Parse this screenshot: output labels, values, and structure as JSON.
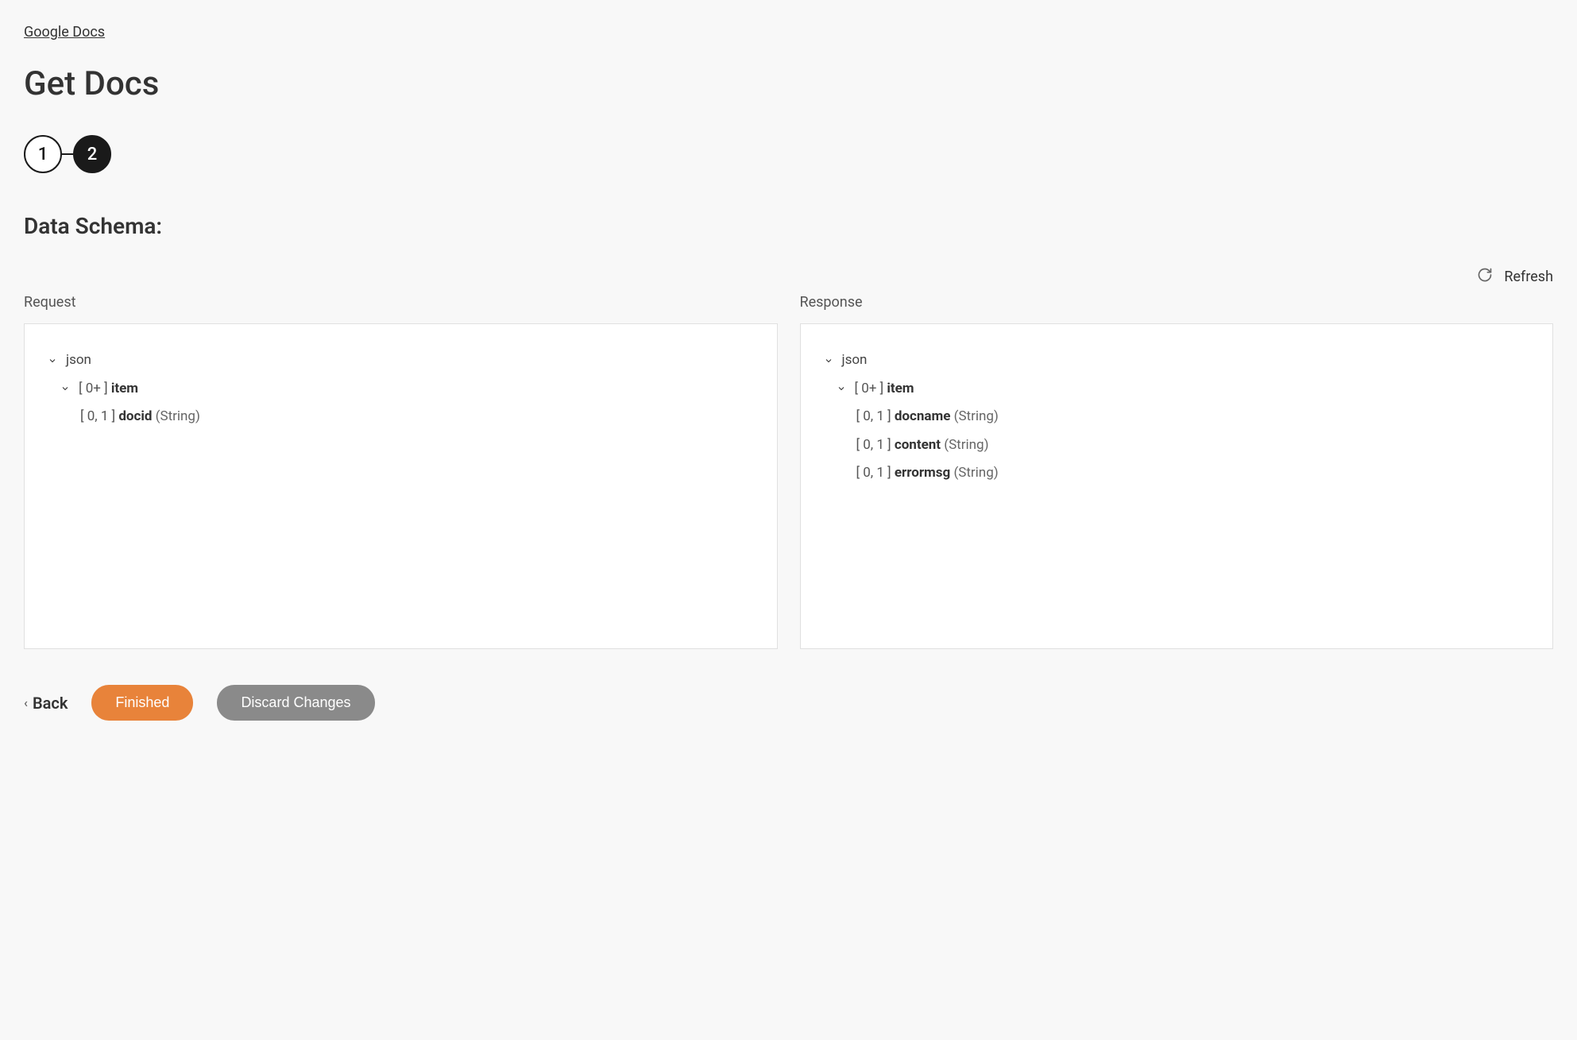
{
  "breadcrumb": {
    "label": "Google Docs"
  },
  "page_title": "Get Docs",
  "stepper": {
    "steps": [
      "1",
      "2"
    ],
    "active_index": 1
  },
  "section_title": "Data Schema:",
  "refresh": {
    "label": "Refresh"
  },
  "request": {
    "title": "Request",
    "root_label": "json",
    "item_prefix": "[ 0+ ]",
    "item_name": "item",
    "fields": [
      {
        "prefix": "[ 0, 1 ]",
        "name": "docid",
        "type": "(String)"
      }
    ]
  },
  "response": {
    "title": "Response",
    "root_label": "json",
    "item_prefix": "[ 0+ ]",
    "item_name": "item",
    "fields": [
      {
        "prefix": "[ 0, 1 ]",
        "name": "docname",
        "type": "(String)"
      },
      {
        "prefix": "[ 0, 1 ]",
        "name": "content",
        "type": "(String)"
      },
      {
        "prefix": "[ 0, 1 ]",
        "name": "errormsg",
        "type": "(String)"
      }
    ]
  },
  "footer": {
    "back_label": "Back",
    "finished_label": "Finished",
    "discard_label": "Discard Changes"
  }
}
